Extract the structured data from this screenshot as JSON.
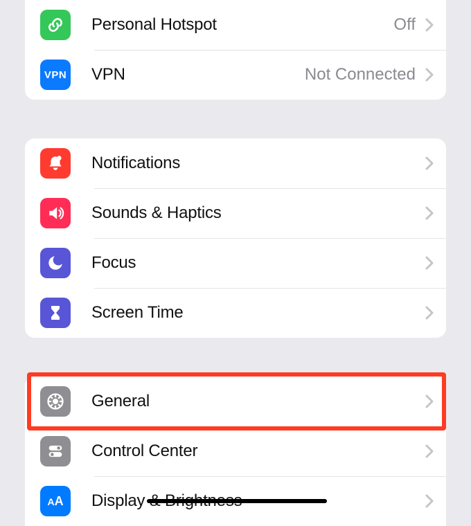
{
  "group1": {
    "items": [
      {
        "label": "Personal Hotspot",
        "status": "Off",
        "icon": "link-icon",
        "color": "green"
      },
      {
        "label": "VPN",
        "status": "Not Connected",
        "icon": "vpn-icon",
        "color": "blue"
      }
    ]
  },
  "group2": {
    "items": [
      {
        "label": "Notifications",
        "icon": "bell-icon",
        "color": "red"
      },
      {
        "label": "Sounds & Haptics",
        "icon": "speaker-icon",
        "color": "pink"
      },
      {
        "label": "Focus",
        "icon": "moon-icon",
        "color": "indigo"
      },
      {
        "label": "Screen Time",
        "icon": "hourglass-icon",
        "color": "indigo"
      }
    ]
  },
  "group3": {
    "items": [
      {
        "label": "General",
        "icon": "gear-icon",
        "color": "gray"
      },
      {
        "label": "Control Center",
        "icon": "toggles-icon",
        "color": "gray"
      },
      {
        "label": "Display & Brightness",
        "icon": "text-size-icon",
        "color": "blue2"
      }
    ]
  },
  "highlighted": "general-row"
}
